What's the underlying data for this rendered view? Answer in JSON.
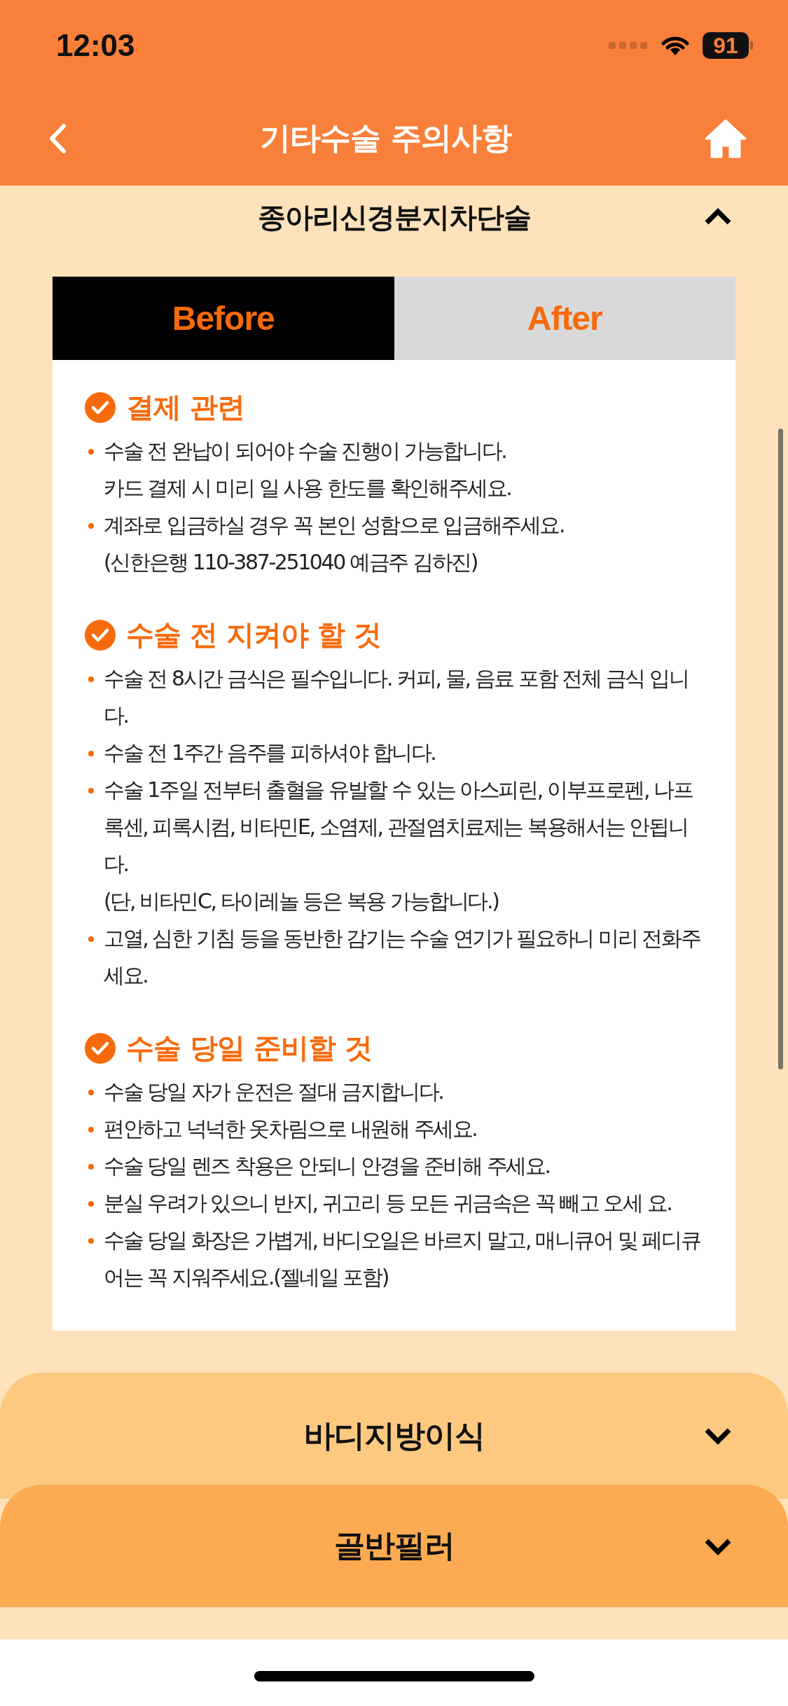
{
  "status_bar": {
    "time": "12:03",
    "battery": "91"
  },
  "nav": {
    "title": "기타수술 주의사항"
  },
  "accordions": [
    {
      "title": "종아리신경분지차단술",
      "expanded": true,
      "tabs": [
        {
          "label": "Before",
          "selected": true
        },
        {
          "label": "After",
          "selected": false
        }
      ],
      "sections": [
        {
          "heading": "결제 관련",
          "items": [
            {
              "lines": [
                "수술 전 완납이 되어야 수술 진행이 가능합니다.",
                "카드 결제 시 미리 일 사용 한도를 확인해주세요."
              ]
            },
            {
              "lines": [
                "계좌로 입금하실 경우 꼭 본인 성함으로 입금해주세요.",
                "(신한은행 110-387-251040 예금주 김하진)"
              ]
            }
          ]
        },
        {
          "heading": "수술 전 지켜야 할 것",
          "items": [
            {
              "lines": [
                "수술 전 8시간 금식은 필수입니다. 커피, 물, 음료 포함 전체 금식 입니다."
              ]
            },
            {
              "lines": [
                "수술 전 1주간 음주를 피하셔야 합니다."
              ]
            },
            {
              "lines": [
                "수술 1주일 전부터 출혈을 유발할 수 있는 아스피린, 이부프로펜, 나프록센, 피록시컴, 비타민E, 소염제, 관절염치료제는 복용해서는 안됩니다.",
                "(단, 비타민C, 타이레놀 등은 복용 가능합니다.)"
              ]
            },
            {
              "lines": [
                "고열, 심한 기침 등을 동반한 감기는 수술 연기가 필요하니 미리 전화주세요."
              ]
            }
          ]
        },
        {
          "heading": "수술 당일 준비할 것",
          "items": [
            {
              "lines": [
                "수술 당일 자가 운전은 절대 금지합니다."
              ]
            },
            {
              "lines": [
                "편안하고 넉넉한 옷차림으로 내원해 주세요."
              ]
            },
            {
              "lines": [
                "수술 당일 렌즈 착용은 안되니 안경을 준비해 주세요."
              ]
            },
            {
              "lines": [
                "분실 우려가 있으니 반지, 귀고리 등 모든 귀금속은 꼭 빼고 오세 요."
              ]
            },
            {
              "lines": [
                "수술 당일 화장은 가볍게, 바디오일은 바르지 말고, 매니큐어 및 페디큐어는 꼭 지워주세요.(젤네일 포함)"
              ]
            }
          ]
        }
      ]
    },
    {
      "title": "바디지방이식",
      "expanded": false
    },
    {
      "title": "골반필러",
      "expanded": false
    }
  ]
}
